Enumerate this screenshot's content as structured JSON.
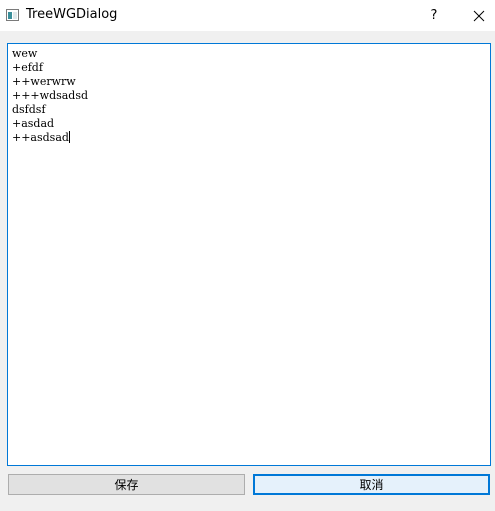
{
  "window": {
    "title": "TreeWGDialog",
    "help_label": "?",
    "close_icon": "close-icon",
    "app_icon": "window-app-icon"
  },
  "editor": {
    "lines": [
      "wew",
      "+efdf",
      "++werwrw",
      "+++wdsadsd",
      "dsfdsf",
      "+asdad",
      "++asdsad"
    ]
  },
  "buttons": {
    "save_label": "保存",
    "cancel_label": "取消"
  },
  "colors": {
    "focus_accent": "#0078d7",
    "background": "#f0f0f0"
  }
}
